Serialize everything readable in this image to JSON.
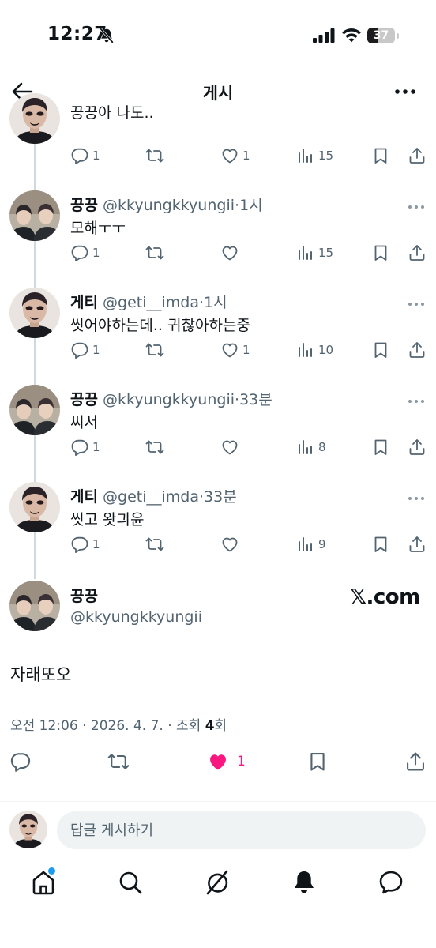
{
  "status_bar": {
    "time": "12:27",
    "battery": "37"
  },
  "header": {
    "title": "게시"
  },
  "replies": [
    {
      "name": "",
      "handle": "",
      "time": "",
      "text": "끙끙아 나도..",
      "replies": "1",
      "retweets": "",
      "likes": "1",
      "views": "15",
      "avatar": "geti"
    },
    {
      "name": "끙끙",
      "handle": "@kkyungkkyungii",
      "time": "1시",
      "text": "모해ㅜㅜ",
      "replies": "1",
      "retweets": "",
      "likes": "",
      "views": "15",
      "avatar": "duo"
    },
    {
      "name": "게티",
      "handle": "@geti__imda",
      "time": "1시",
      "text": "씻어야하는데.. 귀찮아하는중",
      "replies": "1",
      "retweets": "",
      "likes": "1",
      "views": "10",
      "avatar": "geti"
    },
    {
      "name": "끙끙",
      "handle": "@kkyungkkyungii",
      "time": "33분",
      "text": "씨서",
      "replies": "1",
      "retweets": "",
      "likes": "",
      "views": "8",
      "avatar": "duo"
    },
    {
      "name": "게티",
      "handle": "@geti__imda",
      "time": "33분",
      "text": "씻고 왓긔윤",
      "replies": "1",
      "retweets": "",
      "likes": "",
      "views": "9",
      "avatar": "geti"
    }
  ],
  "main_tweet": {
    "name": "끙끙",
    "handle": "@kkyungkkyungii",
    "watermark": "𝕏.com",
    "text": "자래또오",
    "meta_prefix": "오전 12:06 · 2026. 4. 7. · 조회 ",
    "views": "4",
    "meta_suffix": "회",
    "likes": "1"
  },
  "reply_box": {
    "placeholder": "답글 게시하기"
  },
  "colors": {
    "like_pink": "#f91880",
    "text": "#0f1419",
    "muted": "#536471",
    "accent_blue": "#1d9bf0"
  },
  "nav": [
    "home-icon",
    "search-icon",
    "grok-icon",
    "notifications-icon",
    "messages-icon"
  ]
}
